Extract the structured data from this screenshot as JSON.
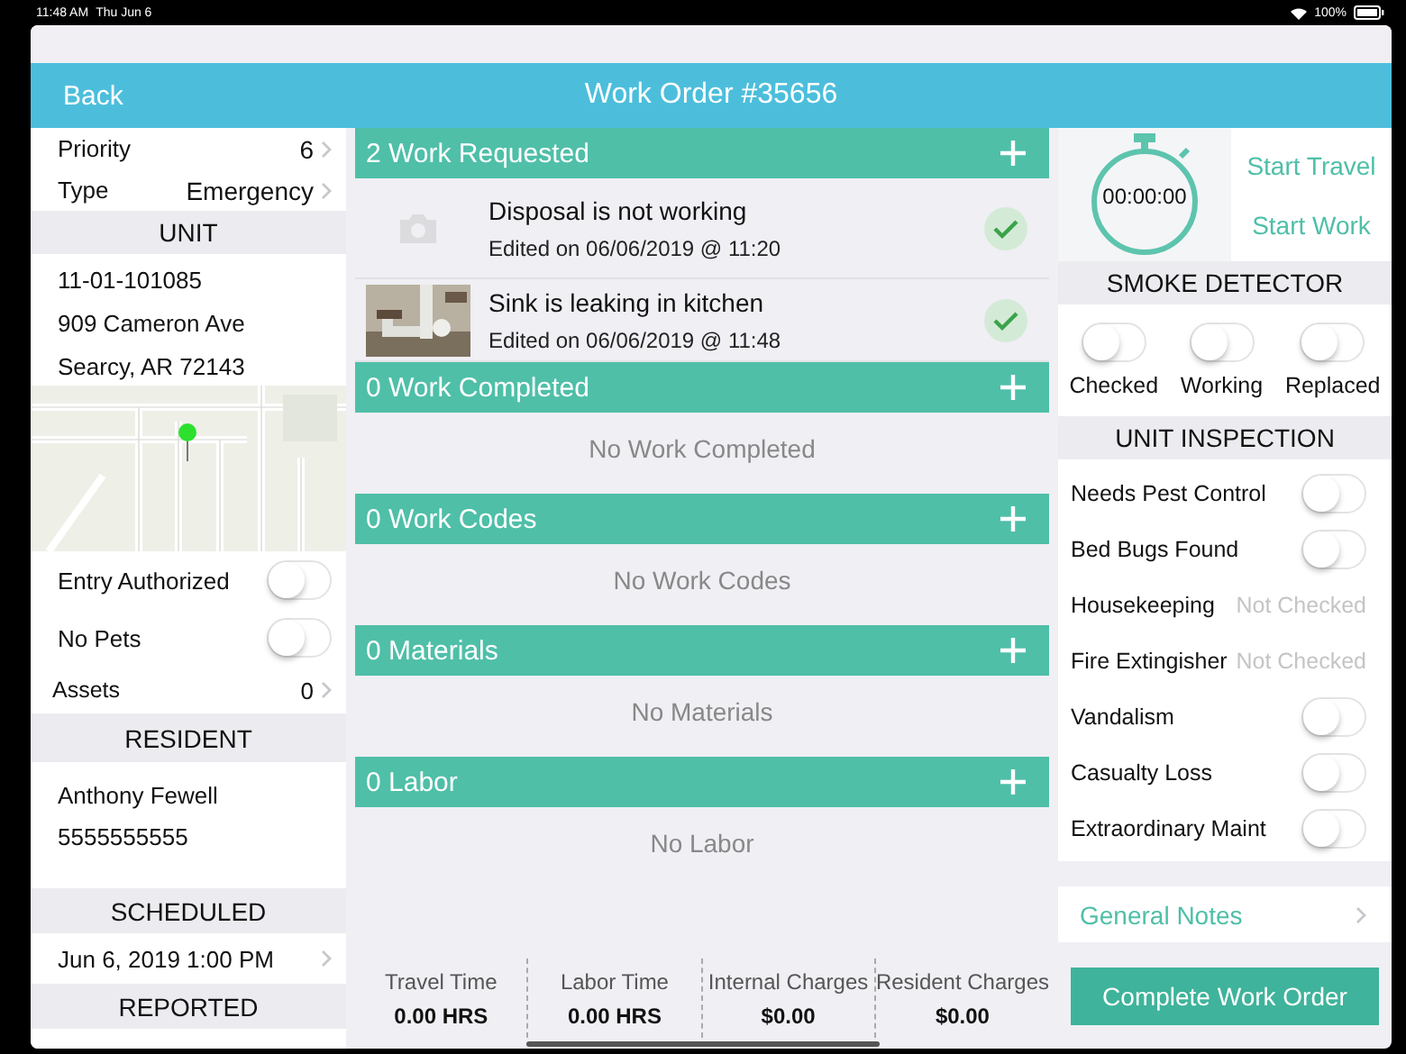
{
  "status_bar": {
    "time": "11:48 AM",
    "date": "Thu Jun 6",
    "battery": "100%"
  },
  "header": {
    "back": "Back",
    "title": "Work Order #35656"
  },
  "left": {
    "fields": [
      {
        "label": "Priority",
        "value": "6"
      },
      {
        "label": "Type",
        "value": "Emergency"
      }
    ],
    "unit": {
      "heading": "UNIT",
      "lines": [
        "11-01-101085",
        "909 Cameron Ave",
        "Searcy, AR 72143"
      ],
      "map": {
        "kind": "picture"
      }
    },
    "toggles": [
      {
        "label": "Entry Authorized",
        "on": false
      },
      {
        "label": "No Pets",
        "on": false
      }
    ],
    "assets": {
      "label": "Assets",
      "value": "0"
    },
    "resident": {
      "heading": "RESIDENT",
      "lines": [
        "Anthony Fewell",
        "5555555555"
      ]
    },
    "scheduled": {
      "heading": "SCHEDULED",
      "value": "Jun 6, 2019 1:00 PM"
    },
    "reported": {
      "heading": "REPORTED"
    }
  },
  "sections": [
    {
      "count": "2",
      "title": "Work Requested",
      "items": [
        {
          "kind": "placeholder",
          "title": "Disposal is not working",
          "edited": "Edited on 06/06/2019 @ 11:20",
          "done": true
        },
        {
          "kind": "picture",
          "title": "Sink is leaking in kitchen",
          "edited": "Edited on 06/06/2019 @ 11:48",
          "done": true
        }
      ]
    },
    {
      "count": "0",
      "title": "Work Completed",
      "empty": "No Work Completed"
    },
    {
      "count": "0",
      "title": "Work Codes",
      "empty": "No Work Codes"
    },
    {
      "count": "0",
      "title": "Materials",
      "empty": "No Materials"
    },
    {
      "count": "0",
      "title": "Labor",
      "empty": "No Labor"
    }
  ],
  "totals": [
    {
      "label": "Travel Time",
      "value": "0.00 HRS"
    },
    {
      "label": "Labor Time",
      "value": "0.00 HRS"
    },
    {
      "label": "Internal Charges",
      "value": "$0.00"
    },
    {
      "label": "Resident Charges",
      "value": "$0.00"
    }
  ],
  "timer": {
    "display": "00:00:00",
    "actions": [
      "Start Travel",
      "Start Work"
    ]
  },
  "smoke_detector": {
    "heading": "SMOKE DETECTOR",
    "toggles": [
      {
        "label": "Checked",
        "on": false
      },
      {
        "label": "Working",
        "on": false
      },
      {
        "label": "Replaced",
        "on": false
      }
    ]
  },
  "inspection": {
    "heading": "UNIT INSPECTION",
    "rows": [
      {
        "kind": "toggle",
        "label": "Needs Pest Control",
        "on": false
      },
      {
        "kind": "toggle",
        "label": "Bed Bugs Found",
        "on": false
      },
      {
        "kind": "status",
        "label": "Housekeeping",
        "value": "Not Checked"
      },
      {
        "kind": "status",
        "label": "Fire Extingisher",
        "value": "Not Checked"
      },
      {
        "kind": "toggle",
        "label": "Vandalism",
        "on": false
      },
      {
        "kind": "toggle",
        "label": "Casualty Loss",
        "on": false
      },
      {
        "kind": "toggle",
        "label": "Extraordinary Maint",
        "on": false
      }
    ]
  },
  "general_notes": "General Notes",
  "complete_button": "Complete Work Order"
}
